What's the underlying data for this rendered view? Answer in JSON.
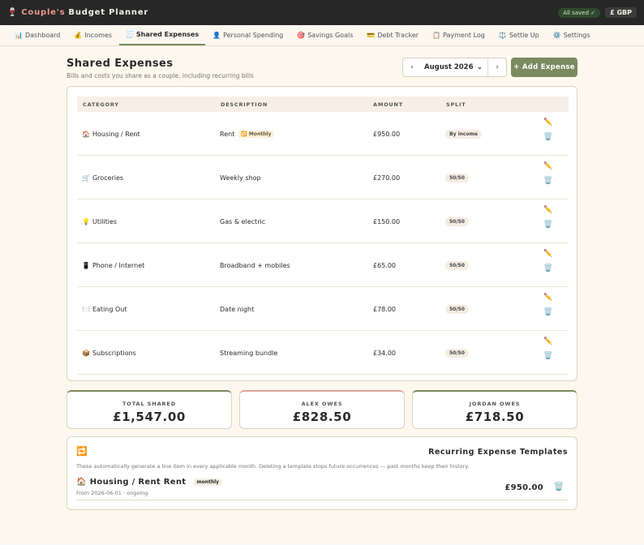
{
  "app": {
    "icon": "🍷",
    "title_accent": "Couple's",
    "title_rest": "Budget Planner",
    "saved_status": "All saved ✓",
    "currency": "£ GBP"
  },
  "nav": [
    {
      "icon": "📊",
      "label": "Dashboard"
    },
    {
      "icon": "💰",
      "label": "Incomes"
    },
    {
      "icon": "🧾",
      "label": "Shared Expenses"
    },
    {
      "icon": "👤",
      "label": "Personal Spending"
    },
    {
      "icon": "🎯",
      "label": "Savings Goals"
    },
    {
      "icon": "💳",
      "label": "Debt Tracker"
    },
    {
      "icon": "📋",
      "label": "Payment Log"
    },
    {
      "icon": "⚖️",
      "label": "Settle Up"
    },
    {
      "icon": "⚙️",
      "label": "Settings"
    }
  ],
  "page": {
    "title": "Shared Expenses",
    "subtitle": "Bills and costs you share as a couple, including recurring bills",
    "month": "August 2026",
    "prev": "‹",
    "next": "›",
    "dropdown": "⌄",
    "add_button": "+ Add Expense"
  },
  "table": {
    "headers": [
      "CATEGORY",
      "DESCRIPTION",
      "AMOUNT",
      "SPLIT"
    ],
    "rows": [
      {
        "icon": "🏠",
        "category": "Housing / Rent",
        "description": "Rent",
        "tag": "🔁 Monthly",
        "amount": "£950.00",
        "split": "By income"
      },
      {
        "icon": "🛒",
        "category": "Groceries",
        "description": "Weekly shop",
        "tag": "",
        "amount": "£270.00",
        "split": "50/50"
      },
      {
        "icon": "💡",
        "category": "Utilities",
        "description": "Gas & electric",
        "tag": "",
        "amount": "£150.00",
        "split": "50/50"
      },
      {
        "icon": "📱",
        "category": "Phone / Internet",
        "description": "Broadband + mobiles",
        "tag": "",
        "amount": "£65.00",
        "split": "50/50"
      },
      {
        "icon": "🍽️",
        "category": "Eating Out",
        "description": "Date night",
        "tag": "",
        "amount": "£78.00",
        "split": "50/50"
      },
      {
        "icon": "📦",
        "category": "Subscriptions",
        "description": "Streaming bundle",
        "tag": "",
        "amount": "£34.00",
        "split": "50/50"
      }
    ],
    "edit_icon": "✏️",
    "delete_icon": "🗑️"
  },
  "summary": [
    {
      "label": "TOTAL SHARED",
      "value": "£1,547.00"
    },
    {
      "label": "ALEX OWES",
      "value": "£828.50"
    },
    {
      "label": "JORDAN OWES",
      "value": "£718.50"
    }
  ],
  "recurring": {
    "icon": "🔁",
    "title": "Recurring Expense Templates",
    "note": "These automatically generate a line item in every applicable month. Deleting a template stops future occurrences — past months keep their history.",
    "item": {
      "icon": "🏠",
      "name": "Housing / Rent Rent",
      "frequency": "monthly",
      "since": "From 2026-06-01 · ongoing",
      "amount": "£950.00",
      "delete_icon": "🗑️"
    }
  }
}
